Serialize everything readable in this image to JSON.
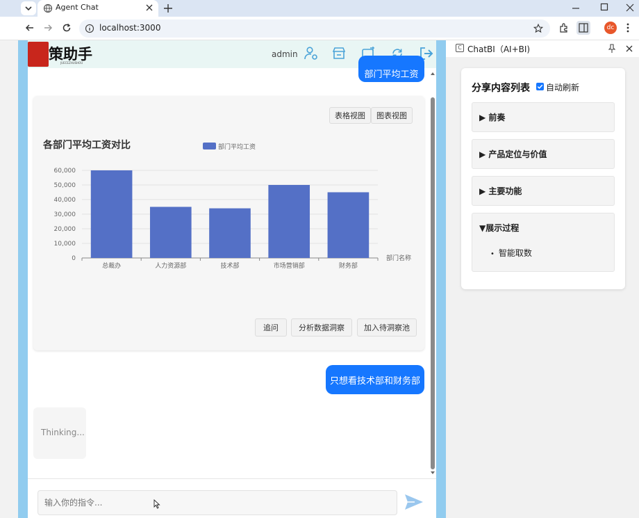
{
  "browser": {
    "tab_title": "Agent Chat",
    "url": "localhost:3000",
    "profile_initials": "dc"
  },
  "app": {
    "logo_text": "策助手",
    "logo_subtext": "JUECEZHUSHOU",
    "username": "admin"
  },
  "chat": {
    "messages": [
      {
        "role": "user",
        "text": "部门平均工资"
      },
      {
        "role": "user",
        "text": "只想看技术部和财务部"
      },
      {
        "role": "assistant",
        "text": "Thinking..."
      }
    ],
    "view_toggle": {
      "table": "表格视图",
      "chart": "图表视图"
    },
    "actions": {
      "followup": "追问",
      "analyze": "分析数据洞察",
      "add_pool": "加入待洞察池"
    },
    "input_placeholder": "输入你的指令..."
  },
  "chart_data": {
    "type": "bar",
    "title": "各部门平均工资对比",
    "legend": "部门平均工资",
    "legend_position": "top-center",
    "xlabel": "部门名称",
    "ylabel": "",
    "categories": [
      "总裁办",
      "人力资源部",
      "技术部",
      "市场营销部",
      "财务部"
    ],
    "values": [
      60000,
      35000,
      34000,
      50000,
      45000
    ],
    "ylim": [
      0,
      60000
    ],
    "yticks": [
      0,
      10000,
      20000,
      30000,
      40000,
      50000,
      60000
    ],
    "ytick_labels": [
      "0",
      "10,000",
      "20,000",
      "30,000",
      "40,000",
      "50,000",
      "60,000"
    ],
    "grid": true,
    "bar_color": "#5470c6"
  },
  "side_panel": {
    "title": "ChatBI（AI+BI)",
    "share_title": "分享内容列表",
    "auto_refresh_label": "自动刷新",
    "auto_refresh_checked": true,
    "sections": [
      {
        "label": "▶ 前奏",
        "expanded": false,
        "items": []
      },
      {
        "label": "▶ 产品定位与价值",
        "expanded": false,
        "items": []
      },
      {
        "label": "▶ 主要功能",
        "expanded": false,
        "items": []
      },
      {
        "label": "▼展示过程",
        "expanded": true,
        "items": [
          "智能取数"
        ]
      }
    ]
  },
  "colors": {
    "primary": "#1677ff",
    "bar": "#5470c6",
    "frame": "#91ccef",
    "header_bg": "#e9f6f4",
    "icon_blue": "#4aa3d8"
  }
}
